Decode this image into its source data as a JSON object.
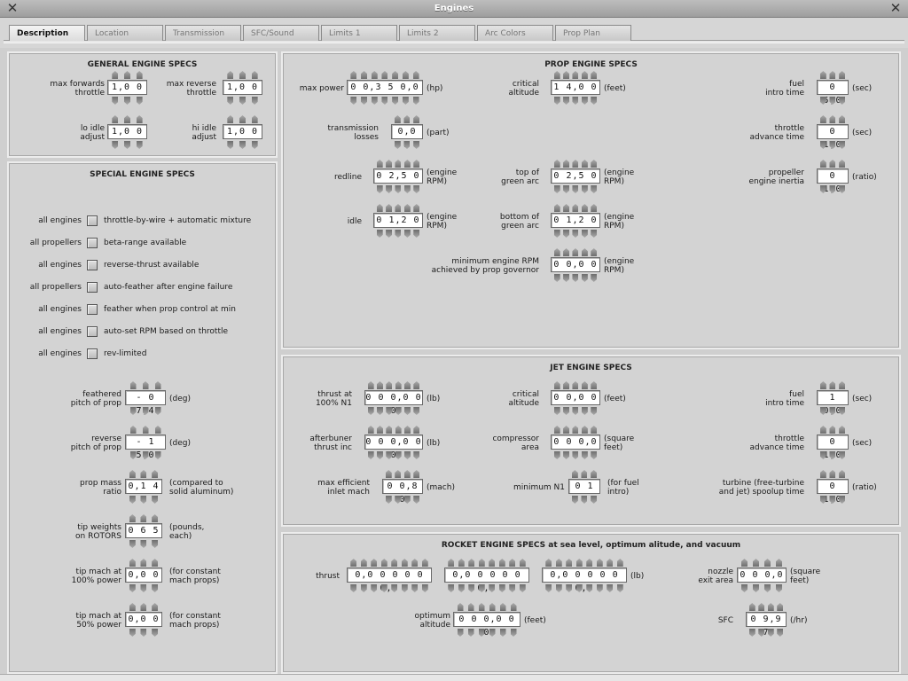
{
  "window": {
    "title": "Engines"
  },
  "tabs": [
    {
      "label": "Description",
      "active": true
    },
    {
      "label": "Location"
    },
    {
      "label": "Transmission"
    },
    {
      "label": "SFC/Sound"
    },
    {
      "label": "Limits 1"
    },
    {
      "label": "Limits 2"
    },
    {
      "label": "Arc Colors"
    },
    {
      "label": "Prop Plan"
    }
  ],
  "general": {
    "title": "GENERAL ENGINE SPECS",
    "max_fwd": {
      "label": "max forwards\nthrottle",
      "value": "1,0 0"
    },
    "max_rev": {
      "label": "max reverse\nthrottle",
      "value": "1,0 0"
    },
    "lo_idle": {
      "label": "lo idle\nadjust",
      "value": "1,0 0"
    },
    "hi_idle": {
      "label": "hi idle\nadjust",
      "value": "1,0 0"
    }
  },
  "special": {
    "title": "SPECIAL ENGINE SPECS",
    "options": [
      {
        "scope": "all engines",
        "text": "throttle-by-wire + automatic mixture"
      },
      {
        "scope": "all propellers",
        "text": "beta-range available"
      },
      {
        "scope": "all engines",
        "text": "reverse-thrust available"
      },
      {
        "scope": "all propellers",
        "text": "auto-feather after engine failure"
      },
      {
        "scope": "all engines",
        "text": "feather when prop control at min"
      },
      {
        "scope": "all engines",
        "text": "auto-set RPM based on throttle"
      },
      {
        "scope": "all engines",
        "text": "rev-limited"
      }
    ],
    "feathered": {
      "label": "feathered\npitch of prop",
      "value": "- 0 7,4",
      "unit": "(deg)"
    },
    "reverse": {
      "label": "reverse\npitch of prop",
      "value": "- 1 5,0",
      "unit": "(deg)"
    },
    "mass_ratio": {
      "label": "prop mass\nratio",
      "value": "0,1 4",
      "unit": "(compared to\nsolid aluminum)"
    },
    "tip_weights": {
      "label": "tip weights\non ROTORS",
      "value": "0 6 5",
      "unit": "(pounds,\neach)"
    },
    "tip_mach_100": {
      "label": "tip mach at\n100% power",
      "value": "0,0 0",
      "unit": "(for constant\nmach props)"
    },
    "tip_mach_50": {
      "label": "tip mach at\n50% power",
      "value": "0,0 0",
      "unit": "(for constant\nmach props)"
    }
  },
  "prop": {
    "title": "PROP ENGINE SPECS",
    "max_power": {
      "label": "max power",
      "value": "0 0,3 5 0,0 0",
      "unit": "(hp)"
    },
    "crit_alt": {
      "label": "critical\naltitude",
      "value": "1 4,0 0 0",
      "unit": "(feet)"
    },
    "fuel_intro": {
      "label": "fuel\nintro time",
      "value": "0 5,0",
      "unit": "(sec)"
    },
    "trans_losses": {
      "label": "transmission\nlosses",
      "value": "0,0 2",
      "unit": "(part)"
    },
    "throttle_adv": {
      "label": "throttle\nadvance time",
      "value": "0 1,0",
      "unit": "(sec)"
    },
    "redline": {
      "label": "redline",
      "value": "0 2,5 0 0",
      "unit": "(engine\nRPM)"
    },
    "top_green": {
      "label": "top of\ngreen arc",
      "value": "0 2,5 0 0",
      "unit": "(engine\nRPM)"
    },
    "prop_inertia": {
      "label": "propeller\nengine inertia",
      "value": "0 1,0",
      "unit": "(ratio)"
    },
    "idle": {
      "label": "idle",
      "value": "0 1,2 0 0",
      "unit": "(engine\nRPM)"
    },
    "bottom_green": {
      "label": "bottom of\ngreen arc",
      "value": "0 1,2 0 0",
      "unit": "(engine\nRPM)"
    },
    "min_rpm": {
      "label": "minimum engine RPM\nachieved by prop governor",
      "value": "0 0,0 0 0",
      "unit": "(engine\nRPM)"
    }
  },
  "jet": {
    "title": "JET ENGINE SPECS",
    "thrust": {
      "label": "thrust at\n100% N1",
      "value": "0 0 0,0 0 0",
      "unit": "(lb)"
    },
    "crit_alt": {
      "label": "critical\naltitude",
      "value": "0 0,0 0 0",
      "unit": "(feet)"
    },
    "fuel_intro": {
      "label": "fuel\nintro time",
      "value": "1 0,0",
      "unit": "(sec)"
    },
    "afterburner": {
      "label": "afterbuner\nthrust inc",
      "value": "0 0 0,0 0 0",
      "unit": "(lb)"
    },
    "compressor": {
      "label": "compressor\narea",
      "value": "0 0 0,0 0",
      "unit": "(square\nfeet)"
    },
    "throttle_adv": {
      "label": "throttle\nadvance time",
      "value": "0 1,0",
      "unit": "(sec)"
    },
    "inlet_mach": {
      "label": "max efficient\ninlet mach",
      "value": "0 0,8 0",
      "unit": "(mach)"
    },
    "min_n1": {
      "label": "minimum N1",
      "value": "0 1 0",
      "unit": "(for fuel\nintro)"
    },
    "spoolup": {
      "label": "turbine (free-turbine\nand jet) spoolup time",
      "value": "0 1,0",
      "unit": "(ratio)"
    }
  },
  "rocket": {
    "title": "ROCKET ENGINE SPECS at sea level, optimum alitude, and vacuum",
    "thrust_label": "thrust",
    "thrust_sl": "0,0 0 0 0 0 0,0",
    "thrust_opt": "0,0 0 0 0 0 0,0",
    "thrust_vac": "0,0 0 0 0 0 0,0",
    "thrust_unit": "(lb)",
    "nozzle": {
      "label": "nozzle\nexit area",
      "value": "0 0 0,0",
      "unit": "(square\nfeet)"
    },
    "opt_alt": {
      "label": "optimum\naltitude",
      "value": "0 0 0,0 0 0",
      "unit": "(feet)"
    },
    "sfc": {
      "label": "SFC",
      "value": "0 9,9 7",
      "unit": "(/hr)"
    }
  }
}
